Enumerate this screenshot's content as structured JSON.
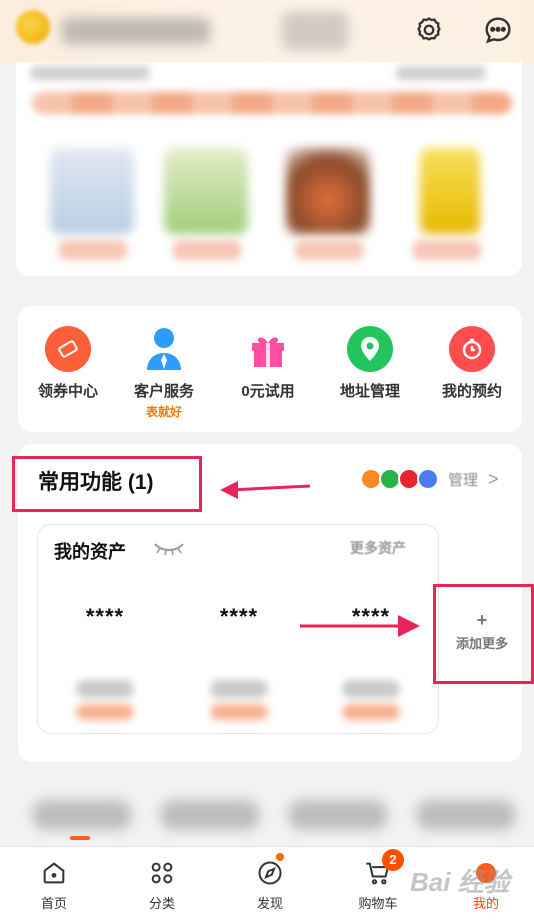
{
  "header": {
    "icons": [
      "settings-gear-icon",
      "message-bubble-icon"
    ]
  },
  "services": [
    {
      "label": "领券中心",
      "icon": "coupon-icon",
      "color": "#ff5e3a"
    },
    {
      "label": "客户服务",
      "sub": "表就好",
      "icon": "service-person-icon",
      "color": "#2d9cff"
    },
    {
      "label": "0元试用",
      "icon": "gift-icon",
      "color": "#ff4fa3"
    },
    {
      "label": "地址管理",
      "icon": "location-pin-icon",
      "color": "#22c45e"
    },
    {
      "label": "我的预约",
      "icon": "clock-icon",
      "color": "#ff4d4d"
    }
  ],
  "functions": {
    "title": "常用功能 (1)",
    "manage_label": "管理",
    "manage_chevron": ">"
  },
  "assets": {
    "title": "我的资产",
    "more_label": "更多资产",
    "values": [
      "****",
      "****",
      "****"
    ]
  },
  "add_more": {
    "plus": "+",
    "label": "添加更多"
  },
  "tabbar": {
    "tabs": [
      {
        "label": "首页",
        "icon": "home-icon"
      },
      {
        "label": "分类",
        "icon": "category-grid-icon"
      },
      {
        "label": "发现",
        "icon": "compass-icon"
      },
      {
        "label": "购物车",
        "icon": "cart-icon",
        "badge": "2"
      },
      {
        "label": "我的",
        "icon": "profile-icon"
      }
    ]
  },
  "watermark": "Bai 经验",
  "colors": {
    "accent": "#ff5000",
    "annotation_red": "#e8245a"
  }
}
